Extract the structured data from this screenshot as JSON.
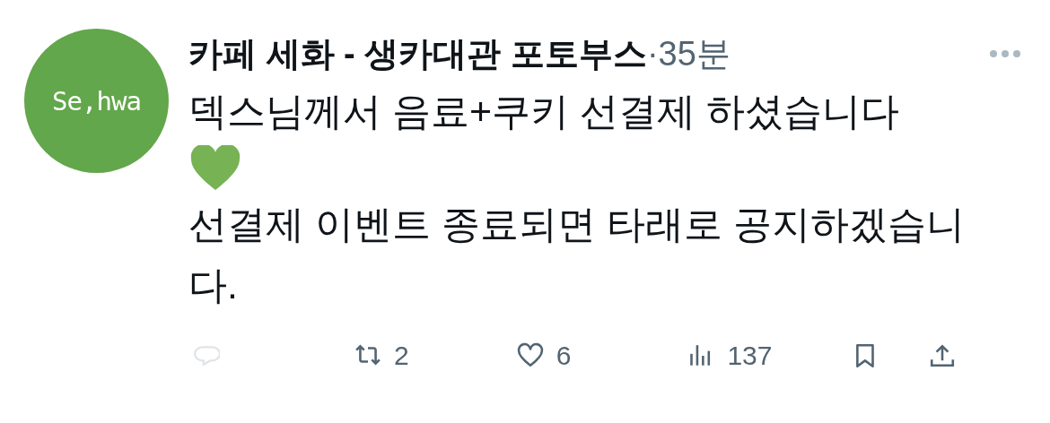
{
  "post": {
    "avatar": {
      "text": "Se,hwa"
    },
    "author": "카페 세화 - 생카대관 포토부스",
    "separator": "·",
    "time": "35분",
    "body": [
      {
        "kind": "text",
        "text": "덱스님께서 음료+쿠키 선결제 하셨습니다"
      },
      {
        "kind": "heart"
      },
      {
        "kind": "text",
        "text": "선결제 이벤트 종료되면 타래로 공지하겠습니다."
      }
    ],
    "actions": [
      {
        "kind": "reply",
        "disabled": true
      },
      {
        "kind": "repost",
        "count": "2",
        "disabled": false
      },
      {
        "kind": "like",
        "count": "6",
        "disabled": false
      },
      {
        "kind": "views",
        "count": "137",
        "disabled": false
      },
      {
        "kind": "bookmark",
        "disabled": false
      },
      {
        "kind": "share",
        "disabled": false
      }
    ]
  }
}
